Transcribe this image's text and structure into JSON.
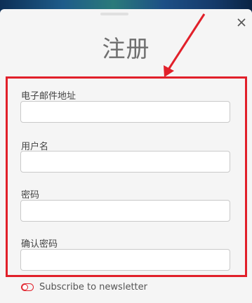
{
  "modal": {
    "title": "注册",
    "close_icon": "close-icon"
  },
  "form": {
    "fields": [
      {
        "label": "电子邮件地址",
        "value": "",
        "placeholder": ""
      },
      {
        "label": "用户名",
        "value": "",
        "placeholder": ""
      },
      {
        "label": "密码",
        "value": "",
        "placeholder": ""
      },
      {
        "label": "确认密码",
        "value": "",
        "placeholder": ""
      }
    ],
    "newsletter": {
      "label": "Subscribe to newsletter",
      "checked": false
    }
  },
  "annotation": {
    "color": "#e1202a"
  }
}
